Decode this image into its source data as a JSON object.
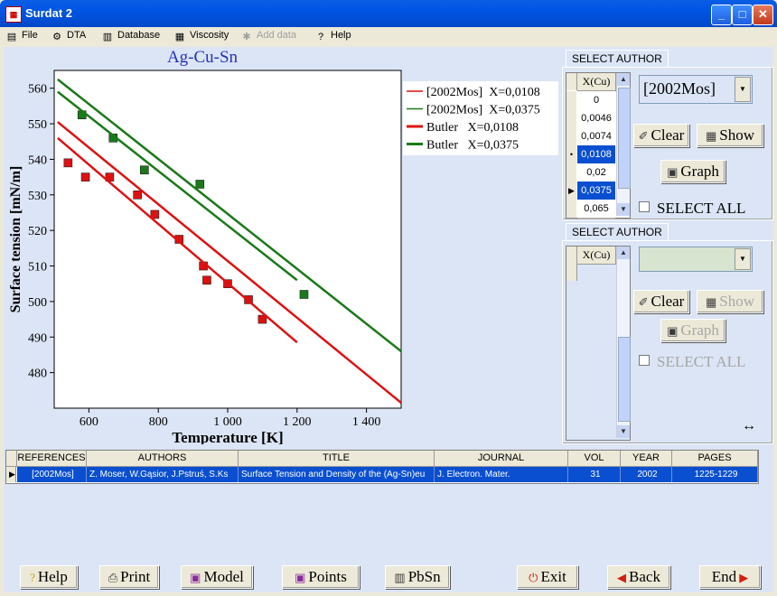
{
  "window": {
    "title": "Surdat 2",
    "icon": "surdat-app-icon"
  },
  "menu": [
    {
      "label": "File",
      "icon": "file-icon",
      "enabled": true
    },
    {
      "label": "DTA",
      "icon": "dta-icon",
      "enabled": true
    },
    {
      "label": "Database",
      "icon": "database-icon",
      "enabled": true
    },
    {
      "label": "Viscosity",
      "icon": "viscosity-icon",
      "enabled": true
    },
    {
      "label": "Add data",
      "icon": "add-data-icon",
      "enabled": false
    },
    {
      "label": "Help",
      "icon": "help-icon",
      "enabled": true
    }
  ],
  "chart_data": {
    "type": "line",
    "title": "Ag-Cu-Sn",
    "xlabel": "Temperature [K]",
    "ylabel": "Surface tension [mN/m]",
    "xlim": [
      500,
      1500
    ],
    "ylim": [
      470,
      565
    ],
    "xticks": [
      "600",
      "800",
      "1 000",
      "1 200",
      "1 400"
    ],
    "yticks": [
      "480",
      "490",
      "500",
      "510",
      "520",
      "530",
      "540",
      "550",
      "560"
    ],
    "legend_position": "right",
    "grid": false,
    "series": [
      {
        "name": "[2002Mos]  X=0,0108",
        "kind": "points",
        "color": "#dd1111",
        "x": [
          540,
          590,
          660,
          740,
          790,
          860,
          930,
          940,
          1000,
          1060,
          1100
        ],
        "y": [
          539,
          535,
          535,
          530,
          524.5,
          517.5,
          510,
          506,
          505,
          500.5,
          495
        ]
      },
      {
        "name": "[2002Mos]  X=0,0375",
        "kind": "points",
        "color": "#1a7a1a",
        "x": [
          580,
          670,
          760,
          920,
          1220
        ],
        "y": [
          552.5,
          546,
          537,
          533,
          502
        ]
      },
      {
        "name": "Butler   X=0,0108",
        "kind": "line",
        "color": "#dd1111",
        "style": "solid",
        "segments": [
          {
            "x": [
              510,
              1500
            ],
            "y": [
              550.5,
              471.5
            ]
          },
          {
            "x": [
              510,
              1200
            ],
            "y": [
              546,
              488.5
            ]
          }
        ]
      },
      {
        "name": "Butler   X=0,0375",
        "kind": "line",
        "color": "#1a7a1a",
        "style": "solid",
        "segments": [
          {
            "x": [
              510,
              1500
            ],
            "y": [
              562.5,
              486
            ]
          },
          {
            "x": [
              510,
              1200
            ],
            "y": [
              559,
              506
            ]
          }
        ]
      }
    ]
  },
  "panel1": {
    "tab": "SELECT AUTHOR",
    "column": "X(Cu)",
    "rows": [
      "0",
      "0,0046",
      "0,0074",
      "0,0108",
      "0,02",
      "0,0375",
      "0,065"
    ],
    "selected": [
      "0,0108",
      "0,0375"
    ],
    "author_value": "[2002Mos]",
    "clear": "Clear",
    "show": "Show",
    "graph": "Graph",
    "select_all": "SELECT ALL"
  },
  "panel2": {
    "tab": "SELECT AUTHOR",
    "column": "X(Cu)",
    "author_value": "",
    "clear": "Clear",
    "show": "Show",
    "graph": "Graph",
    "select_all": "SELECT ALL"
  },
  "references_table": {
    "columns": [
      "REFERENCES",
      "AUTHORS",
      "TITLE",
      "JOURNAL",
      "VOL",
      "YEAR",
      "PAGES"
    ],
    "rows": [
      [
        "[2002Mos]",
        "Z. Moser, W.Gąsior, J.Pstruś, S.Ks",
        "Surface Tension and Density of the (Ag-Sn)eu",
        "J. Electron. Mater.",
        "31",
        "2002",
        "1225-1229"
      ]
    ]
  },
  "buttons": {
    "help": "Help",
    "print": "Print",
    "model": "Model",
    "points": "Points",
    "pbsn": "PbSn",
    "exit": "Exit",
    "back": "Back",
    "end": "End"
  },
  "colors": {
    "accent": "#0a4fcf",
    "background": "#dbe5f5",
    "red_series": "#dd1111",
    "green_series": "#1a7a1a"
  }
}
